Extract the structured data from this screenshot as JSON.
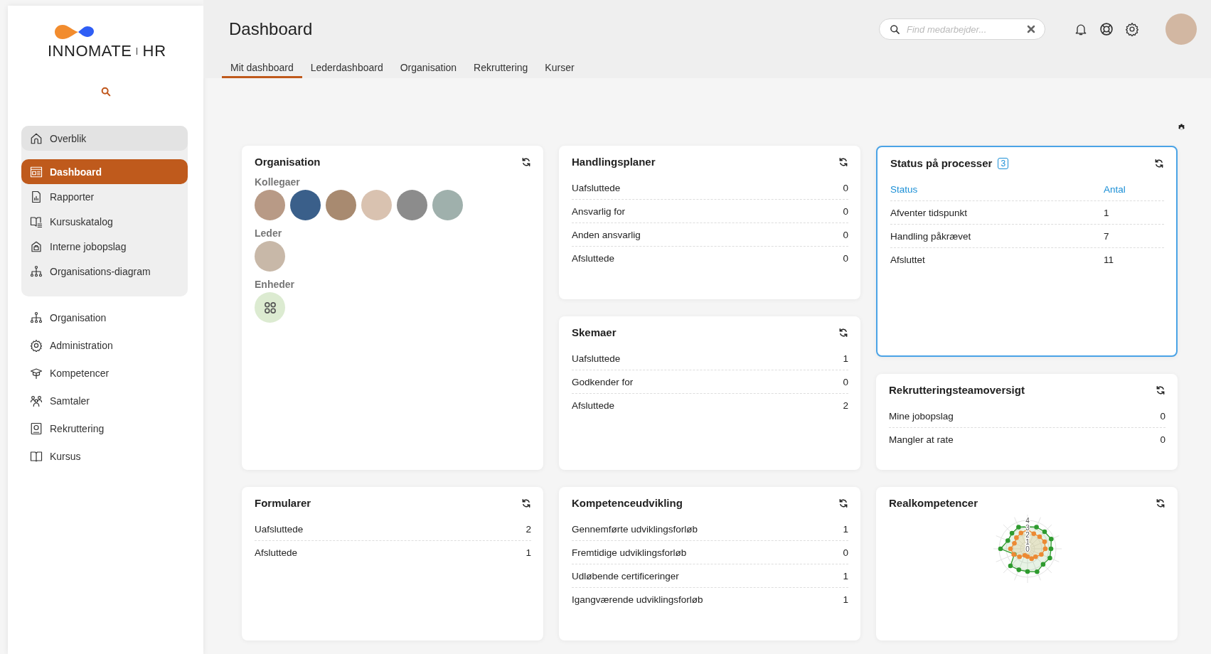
{
  "sidebar": {
    "logo": {
      "wordmark": "INNO**MATE**",
      "suffix": "HR"
    },
    "boxed_items": [
      {
        "label": "Overblik",
        "kind": "overview",
        "selected": false
      },
      {
        "label": "Dashboard",
        "kind": "link",
        "selected": true
      },
      {
        "label": "Rapporter",
        "kind": "link",
        "selected": false
      },
      {
        "label": "Kursuskatalog",
        "kind": "link",
        "selected": false
      },
      {
        "label": "Interne jobopslag",
        "kind": "link",
        "selected": false
      },
      {
        "label": "Organisations-diagram",
        "kind": "link",
        "selected": false
      }
    ],
    "items": [
      {
        "label": "Organisation",
        "selected": false
      },
      {
        "label": "Administration",
        "selected": false
      },
      {
        "label": "Kompetencer",
        "selected": false
      },
      {
        "label": "Samtaler",
        "selected": false
      },
      {
        "label": "Rekruttering",
        "selected": false
      },
      {
        "label": "Kursus",
        "selected": false
      }
    ]
  },
  "header": {
    "title": "Dashboard",
    "search": {
      "placeholder": "Find medarbejder..."
    },
    "tabs": [
      {
        "label": "Mit dashboard",
        "selected": true
      },
      {
        "label": "Lederdashboard",
        "selected": false
      },
      {
        "label": "Organisation",
        "selected": false
      },
      {
        "label": "Rekruttering",
        "selected": false
      },
      {
        "label": "Kurser",
        "selected": false
      }
    ]
  },
  "widget_columns": [
    [
      {
        "kind": "people",
        "title": "Organisation",
        "sections": [
          {
            "label": "Kollegaer",
            "kind": "people"
          },
          {
            "label": "Leder",
            "kind": "people"
          },
          {
            "label": "Enheder",
            "kind": "units"
          }
        ]
      },
      {
        "kind": "counts",
        "title": "Formularer",
        "rows": [
          {
            "label": "Uafsluttede",
            "value": "2"
          },
          {
            "label": "Afsluttede",
            "value": "1"
          }
        ]
      }
    ],
    [
      {
        "kind": "counts",
        "title": "Handlingsplaner",
        "rows": [
          {
            "label": "Uafsluttede",
            "value": "0"
          },
          {
            "label": "Ansvarlig for",
            "value": "0"
          },
          {
            "label": "Anden ansvarlig",
            "value": "0"
          },
          {
            "label": "Afsluttede",
            "value": "0"
          }
        ]
      },
      {
        "kind": "counts",
        "title": "Skemaer",
        "rows": [
          {
            "label": "Uafsluttede",
            "value": "1"
          },
          {
            "label": "Godkender for",
            "value": "0"
          },
          {
            "label": "Afsluttede",
            "value": "2"
          }
        ]
      },
      {
        "kind": "counts",
        "title": "Kompetenceudvikling",
        "rows": [
          {
            "label": "Gennemførte udviklingsforløb",
            "value": "1"
          },
          {
            "label": "Fremtidige udviklingsforløb",
            "value": "0"
          },
          {
            "label": "Udløbende certificeringer",
            "value": "1"
          },
          {
            "label": "Igangværende udviklingsforløb",
            "value": "1"
          }
        ]
      }
    ],
    [
      {
        "kind": "status",
        "title": "Status på processer",
        "badge": "3",
        "focused": true,
        "columns": [
          "Status",
          "Antal"
        ],
        "rows": [
          {
            "label": "Afventer tidspunkt",
            "value": "1"
          },
          {
            "label": "Handling påkrævet",
            "value": "7"
          },
          {
            "label": "Afsluttet",
            "value": "11"
          }
        ]
      },
      {
        "kind": "counts",
        "title": "Rekrutteringsteamoversigt",
        "rows": [
          {
            "label": "Mine jobopslag",
            "value": "0"
          },
          {
            "label": "Mangler at rate",
            "value": "0"
          }
        ]
      },
      {
        "kind": "radar",
        "title": "Realkompetencer",
        "scale_labels": [
          "4",
          "3",
          "2",
          "1",
          "0"
        ]
      }
    ]
  ]
}
